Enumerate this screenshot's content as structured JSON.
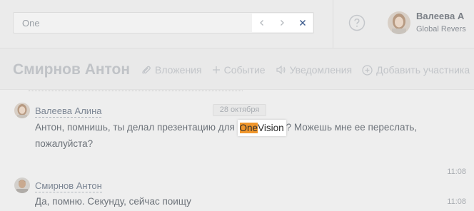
{
  "search": {
    "value": "One"
  },
  "user": {
    "name": "Валеева А",
    "company": "Global Revers"
  },
  "chat": {
    "title": "Смирнов Антон",
    "actions": [
      {
        "label": "Вложения",
        "icon": "paperclip-icon"
      },
      {
        "label": "Событие",
        "icon": "plus-icon"
      },
      {
        "label": "Уведомления",
        "icon": "speaker-icon"
      },
      {
        "label": "Добавить участника",
        "icon": "add-circle-icon"
      }
    ]
  },
  "messages": {
    "date": "28 октября",
    "items": [
      {
        "author": "Валеева Алина",
        "text_before": "Антон, помнишь, ты делал презентацию для ",
        "highlight_match": "One",
        "highlight_rest": "Vision",
        "text_after": "? Можешь мне ее переслать, пожалуйста?",
        "time": "11:08"
      },
      {
        "author": "Смирнов Антон",
        "text": "Да, помню. Секунду, сейчас поищу",
        "time": "11:08"
      }
    ]
  },
  "colors": {
    "highlight": "#f0962b",
    "background": "#eeeeee"
  }
}
